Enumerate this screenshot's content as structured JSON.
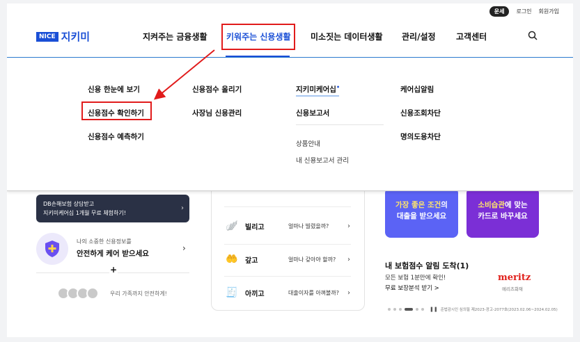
{
  "util": {
    "badge": "운세",
    "login": "로그인",
    "signup": "회원가입"
  },
  "logo": {
    "badge": "NICE",
    "name": "지키미"
  },
  "nav": [
    {
      "label": "지켜주는 금융생활"
    },
    {
      "label": "키워주는 신용생활"
    },
    {
      "label": "미소짓는 데이터생활"
    },
    {
      "label": "관리/설정"
    },
    {
      "label": "고객센터"
    }
  ],
  "menu": {
    "col1": [
      "신용 한눈에 보기",
      "신용점수 확인하기",
      "신용점수 예측하기"
    ],
    "col2": [
      "신용점수 올리기",
      "사장님 신용관리"
    ],
    "col3": {
      "main": [
        "지키미케어십",
        "신용보고서"
      ],
      "dot": "•",
      "sub": [
        "상품안내",
        "내 신용보고서 관리"
      ]
    },
    "col4": [
      "케어십알림",
      "신용조회차단",
      "명의도용차단"
    ]
  },
  "left": {
    "tooltip_line1": "DB손해보험 상담받고",
    "tooltip_line2": "지키미케어십 1개월 무료 체험하기!",
    "care_small": "나의 소중한 신용정보를",
    "care_big": "안전하게 케어 받으세요",
    "plus": "+",
    "family": "우리 가족까지 안전하게!"
  },
  "mid": {
    "rows": [
      {
        "label": "빌리고",
        "question": "얼마나 빌렸을까?"
      },
      {
        "label": "갚고",
        "question": "얼마나 갚아야 할까?"
      },
      {
        "label": "아끼고",
        "question": "대출이자를 아껴볼까?"
      }
    ]
  },
  "promo1": {
    "em": "가장 좋은 조건",
    "rest1": "의",
    "line2": "대출을 받으세요"
  },
  "promo2": {
    "em": "소비습관",
    "rest1": "에 맞는",
    "line2": "카드로 바꾸세요"
  },
  "insurance": {
    "title": "내 보험점수 알림 도착(1)",
    "sub": "모든 보험 1분만에 확인!",
    "link": "무료 보장분석 받기 >",
    "brand": "meritz",
    "brand_sub": "메리츠화재",
    "legal": "준법감시인 심의필 제2023-광고-2077호(2023.02.06~2024.02.05)"
  },
  "colors": {
    "accent": "#1a4fd6",
    "highlight_box": "#e11b1b",
    "promo1": "#5b63f5",
    "promo2": "#7b2fd6"
  }
}
